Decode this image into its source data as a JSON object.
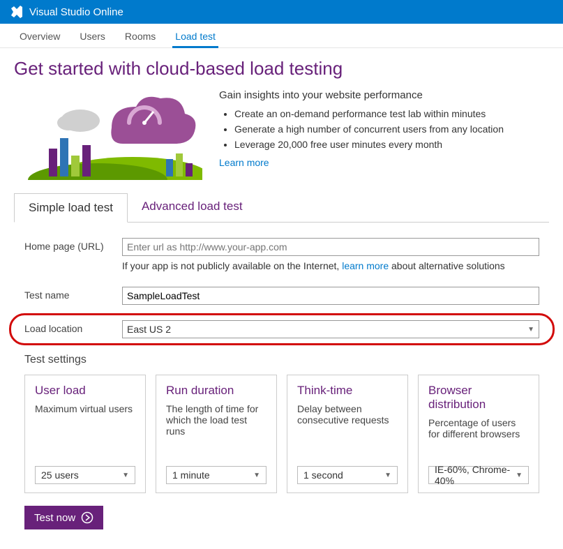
{
  "topbar": {
    "brand": "Visual Studio Online"
  },
  "nav": {
    "tabs": [
      "Overview",
      "Users",
      "Rooms",
      "Load test"
    ],
    "active": "Load test"
  },
  "page_title": "Get started with cloud-based load testing",
  "intro": {
    "lead": "Gain insights into your website performance",
    "bullets": [
      "Create an on-demand performance test lab within minutes",
      "Generate a high number of concurrent users from any location",
      "Leverage 20,000 free user minutes every month"
    ],
    "learn_more": "Learn more"
  },
  "formtabs": {
    "simple": "Simple load test",
    "advanced": "Advanced load test"
  },
  "form": {
    "url_label": "Home page (URL)",
    "url_placeholder": "Enter url as http://www.your-app.com",
    "url_hint_pre": "If your app is not publicly available on the Internet, ",
    "url_hint_link": "learn more",
    "url_hint_post": " about alternative solutions",
    "testname_label": "Test name",
    "testname_value": "SampleLoadTest",
    "location_label": "Load location",
    "location_value": "East US 2"
  },
  "settings": {
    "title": "Test settings",
    "cards": [
      {
        "title": "User load",
        "desc": "Maximum virtual users",
        "value": "25 users"
      },
      {
        "title": "Run duration",
        "desc": "The length of time for which the load test runs",
        "value": "1 minute"
      },
      {
        "title": "Think-time",
        "desc": "Delay between consecutive requests",
        "value": "1 second"
      },
      {
        "title": "Browser distribution",
        "desc": "Percentage of users for different browsers",
        "value": "IE-60%, Chrome-40%"
      }
    ]
  },
  "actions": {
    "test_now": "Test now"
  }
}
